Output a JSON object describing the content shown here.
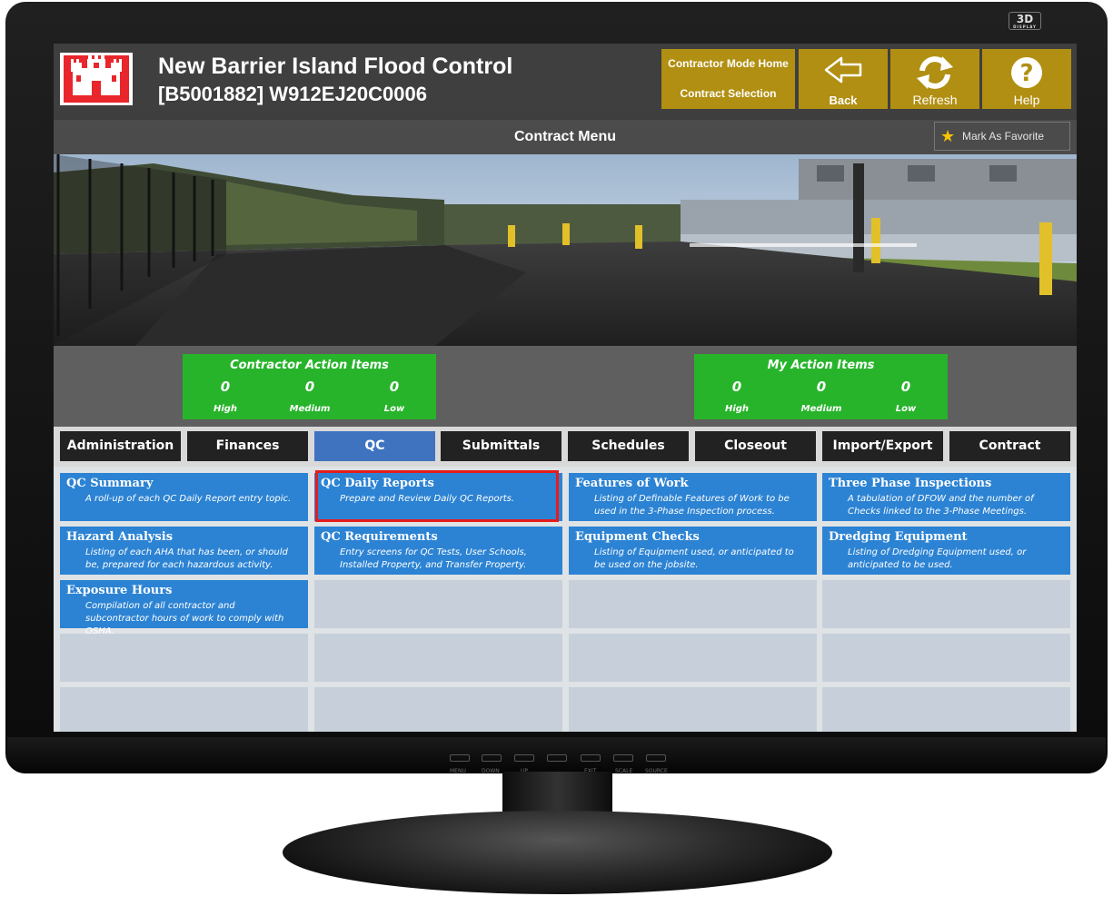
{
  "monitor": {
    "badge": "3D",
    "badge_sub": "DISPLAY",
    "controls": [
      "MENU",
      "DOWN",
      "UP",
      "EXIT",
      "SCALE",
      "SOURCE"
    ]
  },
  "header": {
    "title": "New Barrier Island Flood Control",
    "subtitle": "[B5001882] W912EJ20C0006",
    "contractor_mode_home": "Contractor Mode Home",
    "contract_selection": "Contract Selection",
    "back": "Back",
    "refresh": "Refresh",
    "help": "Help"
  },
  "menubar": {
    "title": "Contract Menu",
    "favorite": "Mark As Favorite"
  },
  "action_items": [
    {
      "title": "Contractor Action Items",
      "high": "0",
      "medium": "0",
      "low": "0",
      "high_label": "High",
      "medium_label": "Medium",
      "low_label": "Low"
    },
    {
      "title": "My Action Items",
      "high": "0",
      "medium": "0",
      "low": "0",
      "high_label": "High",
      "medium_label": "Medium",
      "low_label": "Low"
    }
  ],
  "tabs": [
    {
      "label": "Administration"
    },
    {
      "label": "Finances"
    },
    {
      "label": "QC"
    },
    {
      "label": "Submittals"
    },
    {
      "label": "Schedules"
    },
    {
      "label": "Closeout"
    },
    {
      "label": "Import/Export"
    },
    {
      "label": "Contract Reports"
    }
  ],
  "active_tab": "QC",
  "tiles": [
    {
      "title": "QC Summary",
      "desc": "A roll-up of each QC Daily Report entry topic."
    },
    {
      "title": "QC Daily Reports",
      "desc": "Prepare and Review Daily QC Reports."
    },
    {
      "title": "Features of Work",
      "desc": "Listing of Definable Features of Work to be used in the 3-Phase Inspection process."
    },
    {
      "title": "Three Phase Inspections",
      "desc": "A tabulation of DFOW and the number of Checks linked to the 3-Phase Meetings."
    },
    {
      "title": "Hazard Analysis",
      "desc": "Listing of each AHA that has been, or should be, prepared for each hazardous activity."
    },
    {
      "title": "QC Requirements",
      "desc": "Entry screens for QC Tests, User Schools, Installed Property, and Transfer Property."
    },
    {
      "title": "Equipment Checks",
      "desc": "Listing of Equipment used, or anticipated to be used on the jobsite."
    },
    {
      "title": "Dredging Equipment",
      "desc": "Listing of Dredging Equipment used, or anticipated to be used."
    },
    {
      "title": "Exposure Hours",
      "desc": "Compilation of all contractor and subcontractor hours of work to comply with OSHA."
    }
  ],
  "colors": {
    "gold": "#b18f12",
    "green": "#27b42b",
    "tile_blue": "#2c83d3",
    "tab_active": "#3f73bf",
    "highlight": "#e51c1c"
  }
}
